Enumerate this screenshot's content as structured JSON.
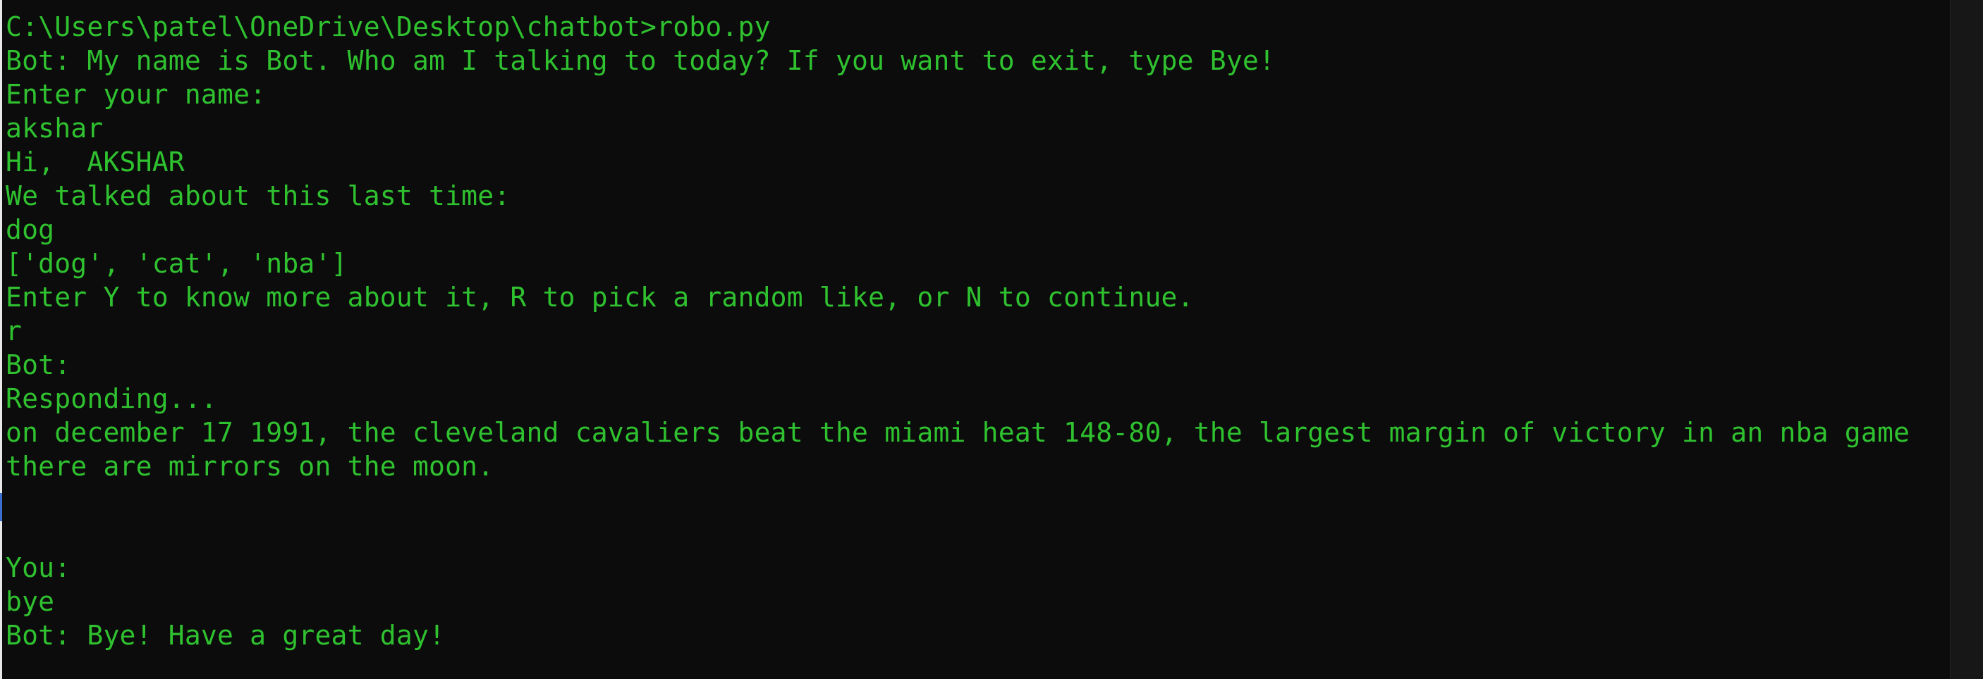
{
  "terminal": {
    "text_color": "#2fc12f",
    "background_color": "#0c0c0c",
    "lines": [
      "C:\\Users\\patel\\OneDrive\\Desktop\\chatbot>robo.py",
      "Bot: My name is Bot. Who am I talking to today? If you want to exit, type Bye!",
      "Enter your name:",
      "akshar",
      "Hi,  AKSHAR",
      "We talked about this last time:",
      "dog",
      "['dog', 'cat', 'nba']",
      "Enter Y to know more about it, R to pick a random like, or N to continue.",
      "r",
      "Bot:",
      "Responding...",
      "on december 17 1991, the cleveland cavaliers beat the miami heat 148-80, the largest margin of victory in an nba game",
      "there are mirrors on the moon.",
      "",
      "",
      "You:",
      "bye",
      "Bot: Bye! Have a great day!"
    ]
  }
}
